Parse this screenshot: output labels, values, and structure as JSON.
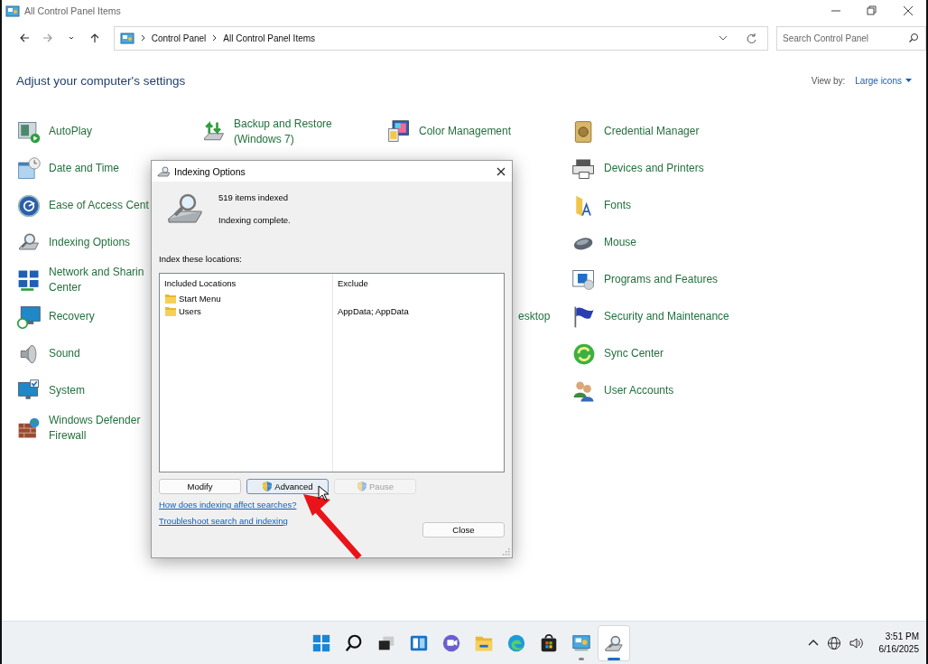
{
  "window": {
    "title": "All Control Panel Items"
  },
  "navigation": {
    "breadcrumb": [
      "Control Panel",
      "All Control Panel Items"
    ],
    "search": {
      "placeholder": "Search Control Panel"
    }
  },
  "header": {
    "heading": "Adjust your computer's settings",
    "view_by_label": "View by:",
    "view_by_value": "Large icons"
  },
  "columns": [
    {
      "items": [
        {
          "kind": "link",
          "label": "AutoPlay"
        },
        {
          "kind": "link",
          "label": "Date and Time"
        },
        {
          "kind": "link",
          "label": "Ease of Access Cent"
        },
        {
          "kind": "link",
          "label": "Indexing Options"
        },
        {
          "kind": "link",
          "label": "Network and Sharin\nCenter"
        },
        {
          "kind": "link",
          "label": "Recovery"
        },
        {
          "kind": "link",
          "label": "Sound"
        },
        {
          "kind": "link",
          "label": "System"
        },
        {
          "kind": "link",
          "label": "Windows Defender\nFirewall"
        }
      ]
    },
    {
      "items": [
        {
          "kind": "link",
          "label": "Backup and Restore\n(Windows 7)"
        }
      ]
    },
    {
      "items": [
        {
          "kind": "link",
          "label": "Color Management"
        },
        {
          "kind": "covered"
        },
        {
          "kind": "covered"
        },
        {
          "kind": "covered"
        },
        {
          "kind": "covered"
        },
        {
          "kind": "partial",
          "label": "esktop"
        }
      ]
    },
    {
      "items": [
        {
          "kind": "link",
          "label": "Credential Manager"
        },
        {
          "kind": "link",
          "label": "Devices and Printers"
        },
        {
          "kind": "link",
          "label": "Fonts"
        },
        {
          "kind": "link",
          "label": "Mouse"
        },
        {
          "kind": "link",
          "label": "Programs and Features"
        },
        {
          "kind": "link",
          "label": "Security and Maintenance"
        },
        {
          "kind": "link",
          "label": "Sync Center"
        },
        {
          "kind": "link",
          "label": "User Accounts"
        }
      ]
    }
  ],
  "dialog": {
    "title": "Indexing Options",
    "count": "519 items indexed",
    "status": "Indexing complete.",
    "locations_label": "Index these locations:",
    "list_columns": [
      "Included Locations",
      "Exclude"
    ],
    "rows": [
      {
        "location": "Start Menu"
      },
      {
        "location": "Users",
        "exclude": "AppData; AppData"
      }
    ],
    "buttons": [
      {
        "label": "Modify",
        "kind": "plain",
        "disabled": false,
        "highlighted": false
      },
      {
        "label": "Advanced",
        "kind": "shield",
        "disabled": false,
        "highlighted": true
      },
      {
        "label": "Pause",
        "kind": "shield",
        "disabled": true,
        "highlighted": false
      }
    ],
    "links": [
      "How does indexing affect searches?",
      "Troubleshoot search and indexing"
    ],
    "close_button": "Close"
  },
  "taskbar": {
    "apps": [
      {
        "running": false,
        "active": false
      },
      {
        "running": false,
        "active": false
      },
      {
        "running": false,
        "active": false
      },
      {
        "running": false,
        "active": false
      },
      {
        "running": false,
        "active": false
      },
      {
        "running": false,
        "active": false
      },
      {
        "running": false,
        "active": false
      },
      {
        "running": false,
        "active": false
      },
      {
        "running": true,
        "active": false
      },
      {
        "running": true,
        "active": true
      }
    ],
    "clock": {
      "time": "3:51 PM",
      "date": "6/16/2025"
    }
  }
}
